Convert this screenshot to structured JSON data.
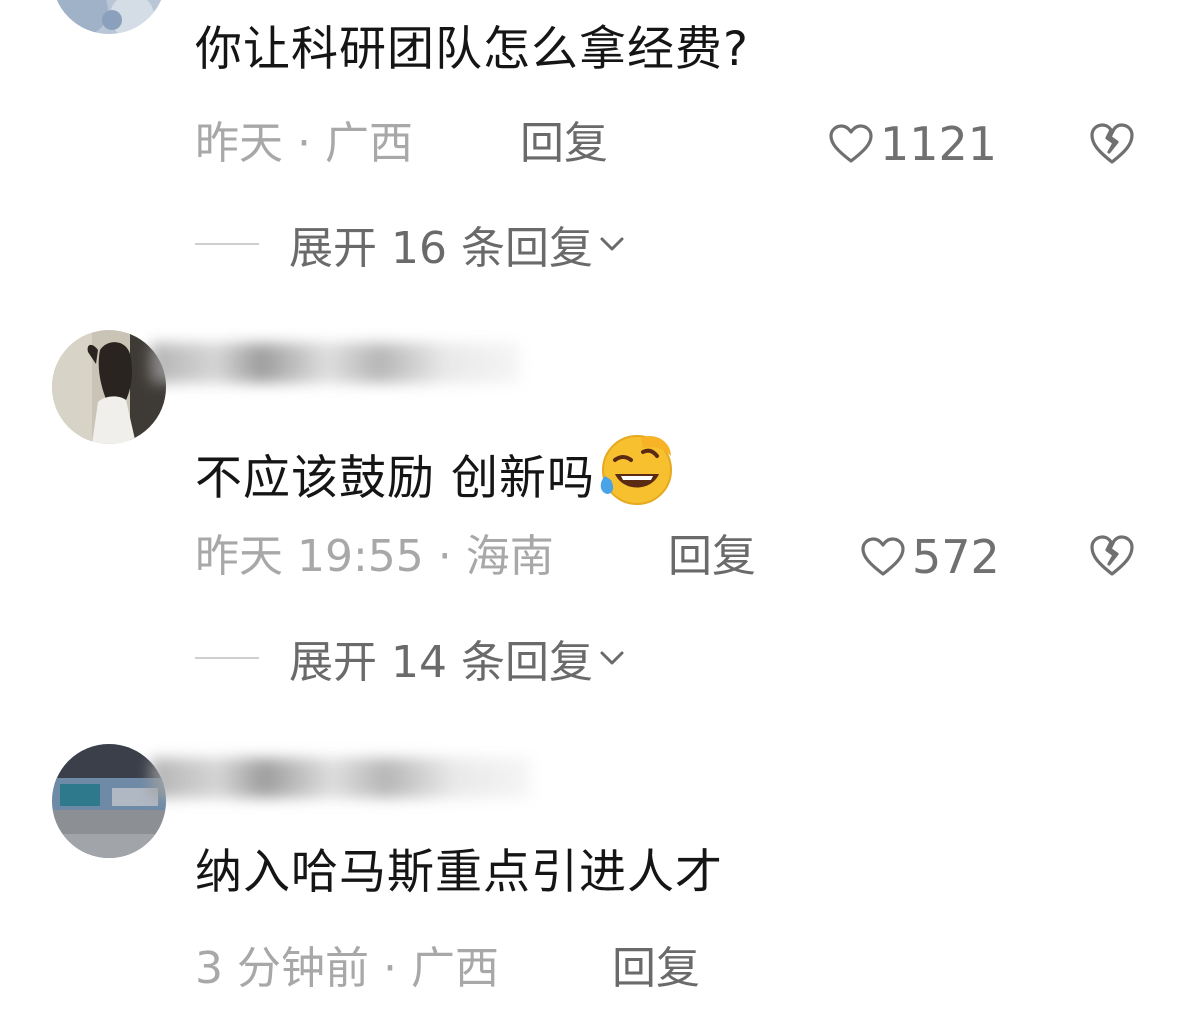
{
  "comments": [
    {
      "text": "你让科研团队怎么拿经费?",
      "time": "昨天",
      "location": "广西",
      "reply_label": "回复",
      "likes": "1121",
      "expand_label": "展开 16 条回复"
    },
    {
      "text": "不应该鼓励 创新吗",
      "emoji": "rolling-on-floor-laughing-emoji",
      "time": "昨天 19:55",
      "location": "海南",
      "reply_label": "回复",
      "likes": "572",
      "expand_label": "展开 14 条回复"
    },
    {
      "text": "纳入哈马斯重点引进人才",
      "time": "3 分钟前",
      "location": "广西",
      "reply_label": "回复"
    }
  ],
  "separator": "·",
  "icons": {
    "like": "heart-outline-icon",
    "dislike": "broken-heart-icon",
    "expand": "chevron-down-icon"
  },
  "colors": {
    "text": "#151515",
    "meta": "#a8a8a8",
    "action": "#6a6a6a"
  }
}
